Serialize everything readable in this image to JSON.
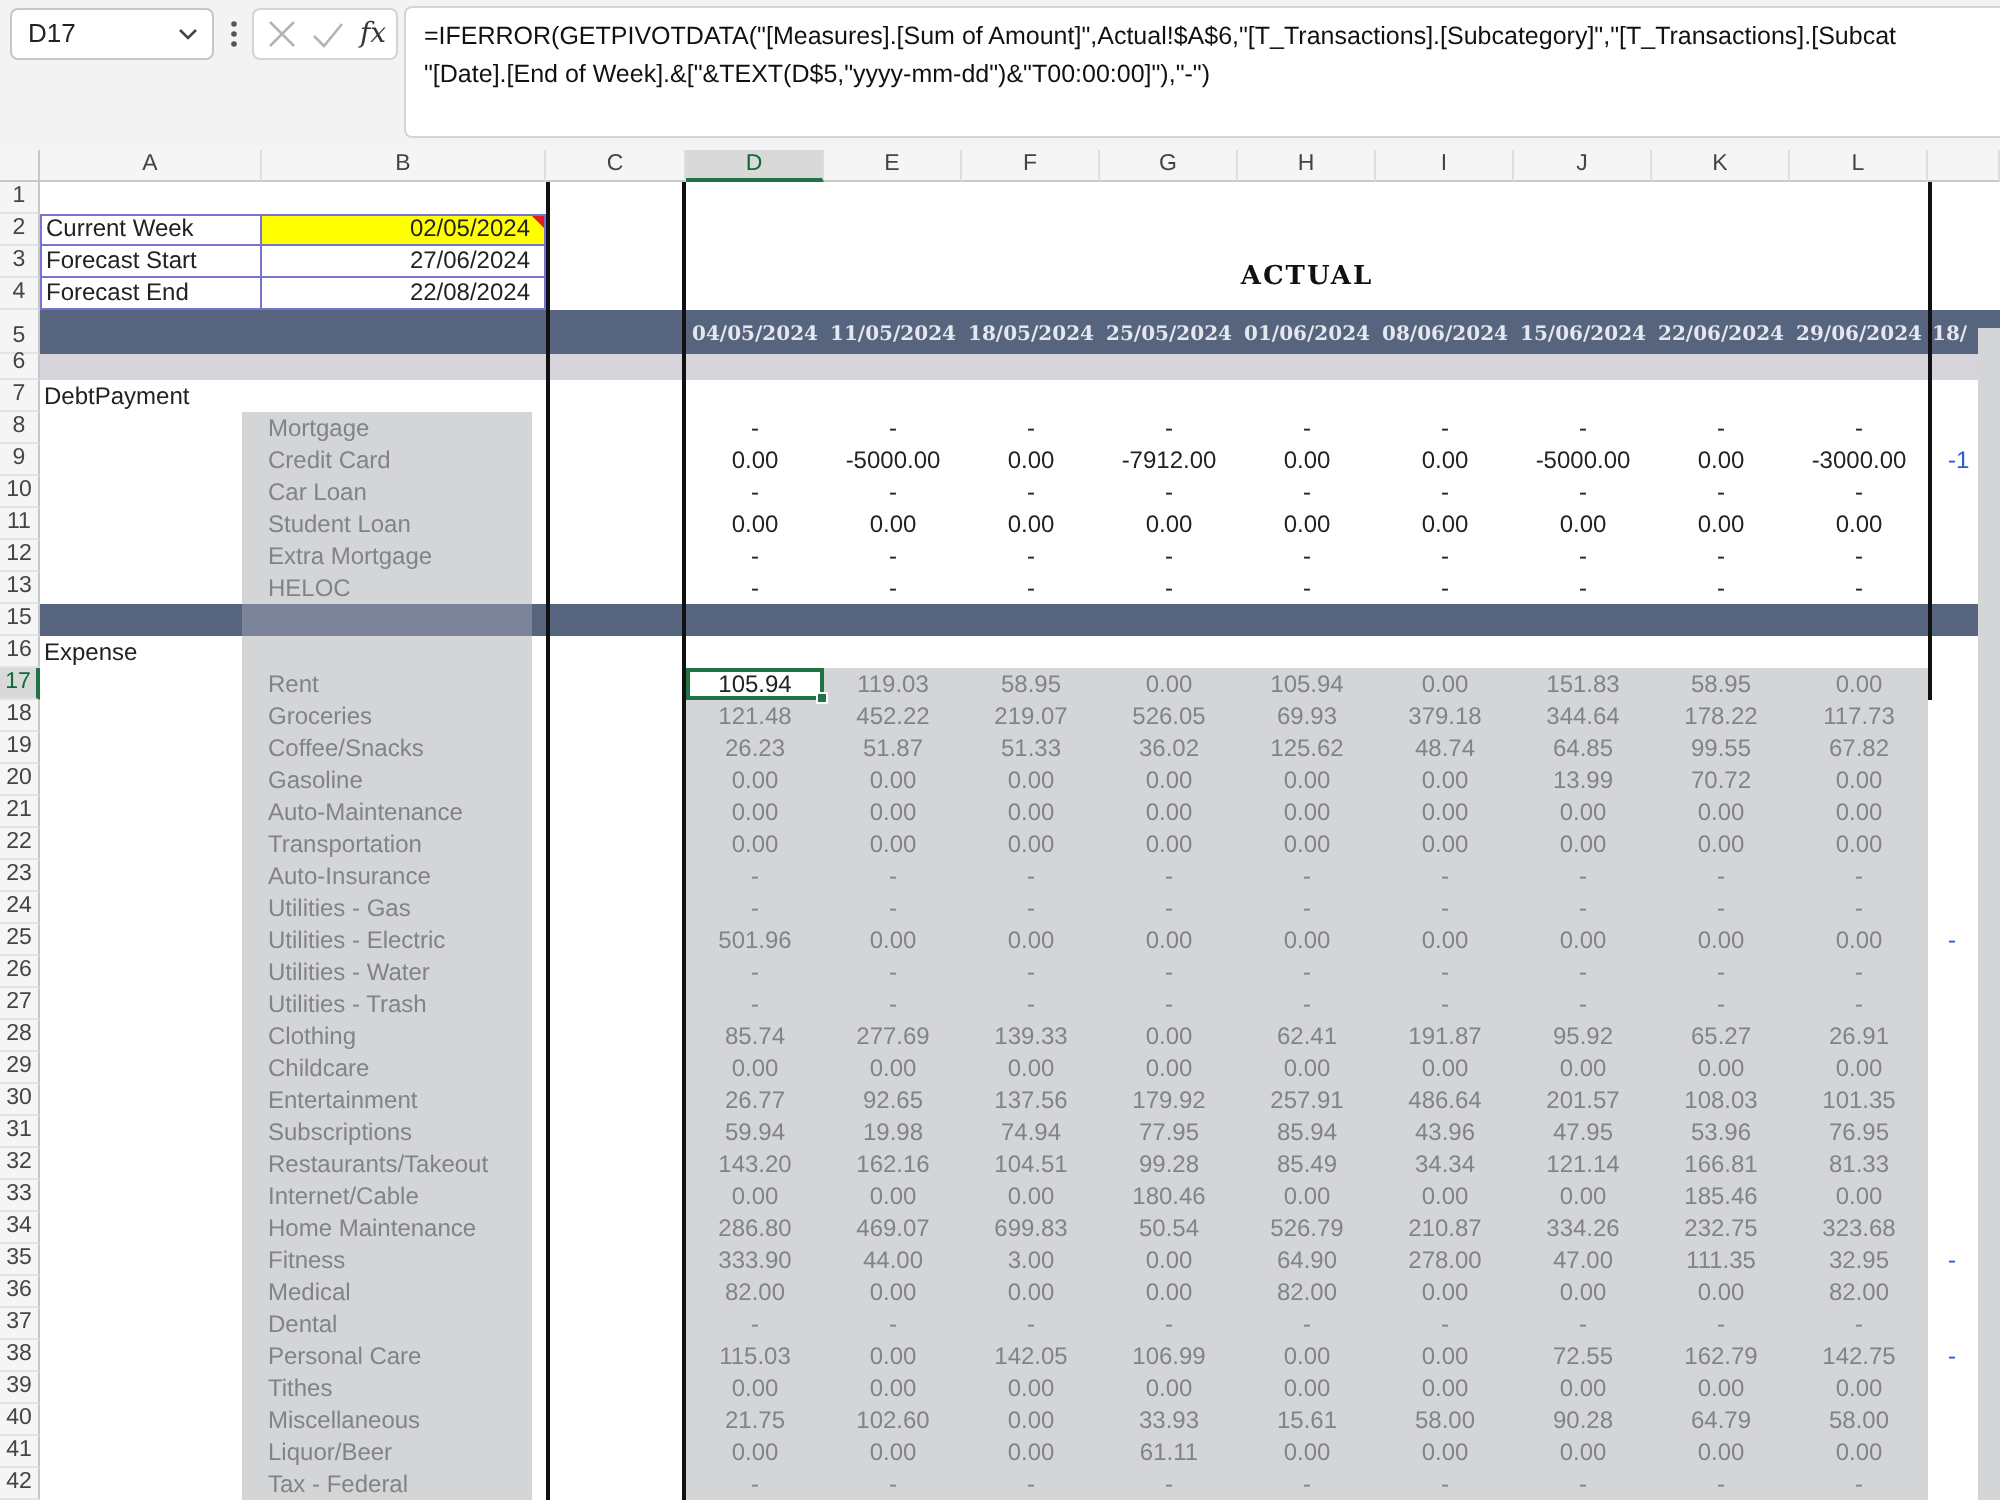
{
  "formula_bar": {
    "name_box": "D17",
    "edit_disabled": true,
    "function_label": "fx",
    "formula_lines": [
      "=IFERROR(GETPIVOTDATA(\"[Measures].[Sum of Amount]\",Actual!$A$6,\"[T_Transactions].[Subcategory]\",\"[T_Transactions].[Subcat",
      "\"[Date].[End of Week].&[\"&TEXT(D$5,\"yyyy-mm-dd\")&\"T00:00:00]\"),\"-\")"
    ]
  },
  "column_headers": [
    {
      "label": "A",
      "selected": false
    },
    {
      "label": "B",
      "selected": false
    },
    {
      "label": "C",
      "selected": false
    },
    {
      "label": "D",
      "selected": true
    },
    {
      "label": "E",
      "selected": false
    },
    {
      "label": "F",
      "selected": false
    },
    {
      "label": "G",
      "selected": false
    },
    {
      "label": "H",
      "selected": false
    },
    {
      "label": "I",
      "selected": false
    },
    {
      "label": "J",
      "selected": false
    },
    {
      "label": "K",
      "selected": false
    },
    {
      "label": "L",
      "selected": false
    }
  ],
  "row_headers": [
    {
      "label": "1",
      "selected": false
    },
    {
      "label": "2",
      "selected": false
    },
    {
      "label": "3",
      "selected": false
    },
    {
      "label": "4",
      "selected": false
    },
    {
      "label": "5",
      "selected": false
    },
    {
      "label": "6",
      "selected": false
    },
    {
      "label": "7",
      "selected": false
    },
    {
      "label": "8",
      "selected": false
    },
    {
      "label": "9",
      "selected": false
    },
    {
      "label": "10",
      "selected": false
    },
    {
      "label": "11",
      "selected": false
    },
    {
      "label": "12",
      "selected": false
    },
    {
      "label": "13",
      "selected": false
    },
    {
      "label": "15",
      "selected": false
    },
    {
      "label": "16",
      "selected": false
    },
    {
      "label": "17",
      "selected": true
    },
    {
      "label": "18",
      "selected": false
    },
    {
      "label": "19",
      "selected": false
    },
    {
      "label": "20",
      "selected": false
    },
    {
      "label": "21",
      "selected": false
    },
    {
      "label": "22",
      "selected": false
    },
    {
      "label": "23",
      "selected": false
    },
    {
      "label": "24",
      "selected": false
    },
    {
      "label": "25",
      "selected": false
    },
    {
      "label": "26",
      "selected": false
    },
    {
      "label": "27",
      "selected": false
    },
    {
      "label": "28",
      "selected": false
    },
    {
      "label": "29",
      "selected": false
    },
    {
      "label": "30",
      "selected": false
    },
    {
      "label": "31",
      "selected": false
    },
    {
      "label": "32",
      "selected": false
    },
    {
      "label": "33",
      "selected": false
    },
    {
      "label": "34",
      "selected": false
    },
    {
      "label": "35",
      "selected": false
    },
    {
      "label": "36",
      "selected": false
    },
    {
      "label": "37",
      "selected": false
    },
    {
      "label": "38",
      "selected": false
    },
    {
      "label": "39",
      "selected": false
    },
    {
      "label": "40",
      "selected": false
    },
    {
      "label": "41",
      "selected": false
    },
    {
      "label": "42",
      "selected": false
    }
  ],
  "settings": [
    {
      "label": "Current Week",
      "value": "02/05/2024",
      "highlighted": true,
      "comment": true
    },
    {
      "label": "Forecast Start",
      "value": "27/06/2024",
      "highlighted": false,
      "comment": false
    },
    {
      "label": "Forecast End",
      "value": "22/08/2024",
      "highlighted": false,
      "comment": false
    }
  ],
  "section_title": "ACTUAL",
  "rows": [
    {
      "kind": "dates",
      "values": [
        "04/05/2024",
        "11/05/2024",
        "18/05/2024",
        "25/05/2024",
        "01/06/2024",
        "08/06/2024",
        "15/06/2024",
        "22/06/2024",
        "29/06/2024"
      ],
      "next_column": "18/",
      "label_shaded": false,
      "values_shaded": false
    },
    {
      "kind": "light_band",
      "label_shaded": false,
      "values_shaded": false
    },
    {
      "kind": "section",
      "label": "DebtPayment",
      "label_shaded": false,
      "values_shaded": false
    },
    {
      "kind": "item",
      "label": "Mortgage",
      "values": [
        "-",
        "-",
        "-",
        "-",
        "-",
        "-",
        "-",
        "-",
        "-"
      ],
      "label_shaded": true,
      "values_shaded": false
    },
    {
      "kind": "item",
      "label": "Credit Card",
      "values": [
        "0.00",
        "-5000.00",
        "0.00",
        "-7912.00",
        "0.00",
        "0.00",
        "-5000.00",
        "0.00",
        "-3000.00"
      ],
      "next_column": "-1",
      "label_shaded": true,
      "values_shaded": false
    },
    {
      "kind": "item",
      "label": "Car Loan",
      "values": [
        "-",
        "-",
        "-",
        "-",
        "-",
        "-",
        "-",
        "-",
        "-"
      ],
      "label_shaded": true,
      "values_shaded": false
    },
    {
      "kind": "item",
      "label": "Student Loan",
      "values": [
        "0.00",
        "0.00",
        "0.00",
        "0.00",
        "0.00",
        "0.00",
        "0.00",
        "0.00",
        "0.00"
      ],
      "label_shaded": true,
      "values_shaded": false
    },
    {
      "kind": "item",
      "label": "Extra Mortgage",
      "values": [
        "-",
        "-",
        "-",
        "-",
        "-",
        "-",
        "-",
        "-",
        "-"
      ],
      "label_shaded": true,
      "values_shaded": false
    },
    {
      "kind": "item",
      "label": "HELOC",
      "values": [
        "-",
        "-",
        "-",
        "-",
        "-",
        "-",
        "-",
        "-",
        "-"
      ],
      "label_shaded": true,
      "values_shaded": false
    },
    {
      "kind": "band",
      "label_shaded": true,
      "values_shaded": false
    },
    {
      "kind": "section",
      "label": "Expense",
      "label_shaded": true,
      "values_shaded": false
    },
    {
      "kind": "item",
      "label": "Rent",
      "values": [
        "105.94",
        "119.03",
        "58.95",
        "0.00",
        "105.94",
        "0.00",
        "151.83",
        "58.95",
        "0.00"
      ],
      "label_shaded": true,
      "values_shaded": true
    },
    {
      "kind": "item",
      "label": "Groceries",
      "values": [
        "121.48",
        "452.22",
        "219.07",
        "526.05",
        "69.93",
        "379.18",
        "344.64",
        "178.22",
        "117.73"
      ],
      "label_shaded": true,
      "values_shaded": true
    },
    {
      "kind": "item",
      "label": "Coffee/Snacks",
      "values": [
        "26.23",
        "51.87",
        "51.33",
        "36.02",
        "125.62",
        "48.74",
        "64.85",
        "99.55",
        "67.82"
      ],
      "label_shaded": true,
      "values_shaded": true
    },
    {
      "kind": "item",
      "label": "Gasoline",
      "values": [
        "0.00",
        "0.00",
        "0.00",
        "0.00",
        "0.00",
        "0.00",
        "13.99",
        "70.72",
        "0.00"
      ],
      "label_shaded": true,
      "values_shaded": true
    },
    {
      "kind": "item",
      "label": "Auto-Maintenance",
      "values": [
        "0.00",
        "0.00",
        "0.00",
        "0.00",
        "0.00",
        "0.00",
        "0.00",
        "0.00",
        "0.00"
      ],
      "label_shaded": true,
      "values_shaded": true
    },
    {
      "kind": "item",
      "label": "Transportation",
      "values": [
        "0.00",
        "0.00",
        "0.00",
        "0.00",
        "0.00",
        "0.00",
        "0.00",
        "0.00",
        "0.00"
      ],
      "label_shaded": true,
      "values_shaded": true
    },
    {
      "kind": "item",
      "label": "Auto-Insurance",
      "values": [
        "-",
        "-",
        "-",
        "-",
        "-",
        "-",
        "-",
        "-",
        "-"
      ],
      "label_shaded": true,
      "values_shaded": true
    },
    {
      "kind": "item",
      "label": "Utilities - Gas",
      "values": [
        "-",
        "-",
        "-",
        "-",
        "-",
        "-",
        "-",
        "-",
        "-"
      ],
      "label_shaded": true,
      "values_shaded": true
    },
    {
      "kind": "item",
      "label": "Utilities - Electric",
      "values": [
        "501.96",
        "0.00",
        "0.00",
        "0.00",
        "0.00",
        "0.00",
        "0.00",
        "0.00",
        "0.00"
      ],
      "next_column": "-",
      "label_shaded": true,
      "values_shaded": true
    },
    {
      "kind": "item",
      "label": "Utilities - Water",
      "values": [
        "-",
        "-",
        "-",
        "-",
        "-",
        "-",
        "-",
        "-",
        "-"
      ],
      "label_shaded": true,
      "values_shaded": true
    },
    {
      "kind": "item",
      "label": "Utilities - Trash",
      "values": [
        "-",
        "-",
        "-",
        "-",
        "-",
        "-",
        "-",
        "-",
        "-"
      ],
      "label_shaded": true,
      "values_shaded": true
    },
    {
      "kind": "item",
      "label": "Clothing",
      "values": [
        "85.74",
        "277.69",
        "139.33",
        "0.00",
        "62.41",
        "191.87",
        "95.92",
        "65.27",
        "26.91"
      ],
      "label_shaded": true,
      "values_shaded": true
    },
    {
      "kind": "item",
      "label": "Childcare",
      "values": [
        "0.00",
        "0.00",
        "0.00",
        "0.00",
        "0.00",
        "0.00",
        "0.00",
        "0.00",
        "0.00"
      ],
      "label_shaded": true,
      "values_shaded": true
    },
    {
      "kind": "item",
      "label": "Entertainment",
      "values": [
        "26.77",
        "92.65",
        "137.56",
        "179.92",
        "257.91",
        "486.64",
        "201.57",
        "108.03",
        "101.35"
      ],
      "label_shaded": true,
      "values_shaded": true
    },
    {
      "kind": "item",
      "label": "Subscriptions",
      "values": [
        "59.94",
        "19.98",
        "74.94",
        "77.95",
        "85.94",
        "43.96",
        "47.95",
        "53.96",
        "76.95"
      ],
      "label_shaded": true,
      "values_shaded": true
    },
    {
      "kind": "item",
      "label": "Restaurants/Takeout",
      "values": [
        "143.20",
        "162.16",
        "104.51",
        "99.28",
        "85.49",
        "34.34",
        "121.14",
        "166.81",
        "81.33"
      ],
      "label_shaded": true,
      "values_shaded": true
    },
    {
      "kind": "item",
      "label": "Internet/Cable",
      "values": [
        "0.00",
        "0.00",
        "0.00",
        "180.46",
        "0.00",
        "0.00",
        "0.00",
        "185.46",
        "0.00"
      ],
      "label_shaded": true,
      "values_shaded": true
    },
    {
      "kind": "item",
      "label": "Home Maintenance",
      "values": [
        "286.80",
        "469.07",
        "699.83",
        "50.54",
        "526.79",
        "210.87",
        "334.26",
        "232.75",
        "323.68"
      ],
      "label_shaded": true,
      "values_shaded": true
    },
    {
      "kind": "item",
      "label": "Fitness",
      "values": [
        "333.90",
        "44.00",
        "3.00",
        "0.00",
        "64.90",
        "278.00",
        "47.00",
        "111.35",
        "32.95"
      ],
      "next_column": "-",
      "label_shaded": true,
      "values_shaded": true
    },
    {
      "kind": "item",
      "label": "Medical",
      "values": [
        "82.00",
        "0.00",
        "0.00",
        "0.00",
        "82.00",
        "0.00",
        "0.00",
        "0.00",
        "82.00"
      ],
      "label_shaded": true,
      "values_shaded": true
    },
    {
      "kind": "item",
      "label": "Dental",
      "values": [
        "-",
        "-",
        "-",
        "-",
        "-",
        "-",
        "-",
        "-",
        "-"
      ],
      "label_shaded": true,
      "values_shaded": true
    },
    {
      "kind": "item",
      "label": "Personal Care",
      "values": [
        "115.03",
        "0.00",
        "142.05",
        "106.99",
        "0.00",
        "0.00",
        "72.55",
        "162.79",
        "142.75"
      ],
      "next_column": "-",
      "label_shaded": true,
      "values_shaded": true
    },
    {
      "kind": "item",
      "label": "Tithes",
      "values": [
        "0.00",
        "0.00",
        "0.00",
        "0.00",
        "0.00",
        "0.00",
        "0.00",
        "0.00",
        "0.00"
      ],
      "label_shaded": true,
      "values_shaded": true
    },
    {
      "kind": "item",
      "label": "Miscellaneous",
      "values": [
        "21.75",
        "102.60",
        "0.00",
        "33.93",
        "15.61",
        "58.00",
        "90.28",
        "64.79",
        "58.00"
      ],
      "label_shaded": true,
      "values_shaded": true
    },
    {
      "kind": "item",
      "label": "Liquor/Beer",
      "values": [
        "0.00",
        "0.00",
        "0.00",
        "61.11",
        "0.00",
        "0.00",
        "0.00",
        "0.00",
        "0.00"
      ],
      "label_shaded": true,
      "values_shaded": true
    },
    {
      "kind": "item",
      "label": "Tax - Federal",
      "values": [
        "-",
        "-",
        "-",
        "-",
        "-",
        "-",
        "-",
        "-",
        "-"
      ],
      "label_shaded": true,
      "values_shaded": true
    }
  ]
}
